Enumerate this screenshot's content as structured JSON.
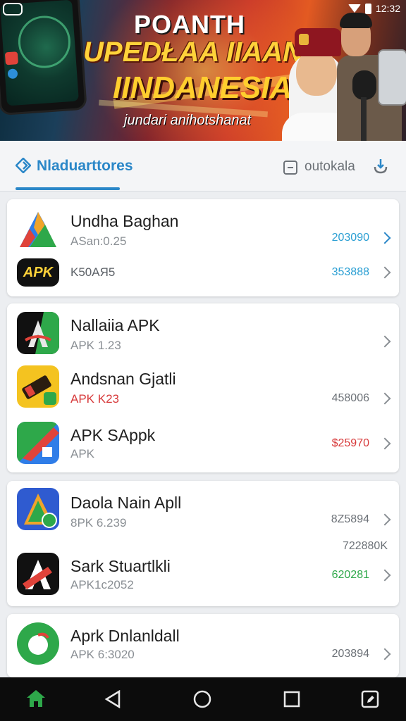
{
  "status_bar": {
    "time": "12:32"
  },
  "banner": {
    "line1": "POANTH",
    "line2": "UPEDŁAA IIAANA",
    "line3": "IINDANESIA",
    "line4": "jundari anihotshanat"
  },
  "tabs": {
    "active_label": "Nladuarttores",
    "second_label": "outokala"
  },
  "cards": [
    {
      "rows": [
        {
          "name": "Undha Baghan",
          "sub": "ASan:0.25",
          "value": "203090",
          "value_color": "#2b9fd3"
        },
        {
          "name": "",
          "sub": "K50AЯ5",
          "value": "353888",
          "value_color": "#2b9fd3"
        }
      ]
    },
    {
      "rows": [
        {
          "name": "Nallaiia APK",
          "sub": "APK 1.23",
          "value": ""
        },
        {
          "name": "Andsnan Gjatli",
          "sub": "APK K23",
          "value": "458006",
          "value_color": "#6d7278"
        },
        {
          "name": "APK SAppk",
          "sub": "APK",
          "value": "$25970",
          "value_color": "#d7393a"
        }
      ]
    },
    {
      "rows": [
        {
          "name": "Daola Nain Apll",
          "sub": "8PK 6.239",
          "value": "8Z5894",
          "value_color": "#6d7278"
        },
        {
          "name": "Sark Stuartlkli",
          "sub": "APK1c2052",
          "value": "620281",
          "value_color": "#2ea84a"
        }
      ],
      "extra_value": "722880K"
    },
    {
      "rows": [
        {
          "name": "Aprk Dnlanldall",
          "sub": "APK 6:3020",
          "value": "203894",
          "value_color": "#6d7278"
        }
      ]
    }
  ],
  "icons": {
    "apk_badge_text": "APK",
    "tab_icon": "diamond-icon",
    "download_icon": "download-icon",
    "nav": [
      "home-icon",
      "back-icon",
      "home-circle-icon",
      "recents-icon",
      "edit-icon"
    ]
  },
  "colors": {
    "accent": "#2b87c8",
    "nav_home": "#2ea84a"
  }
}
